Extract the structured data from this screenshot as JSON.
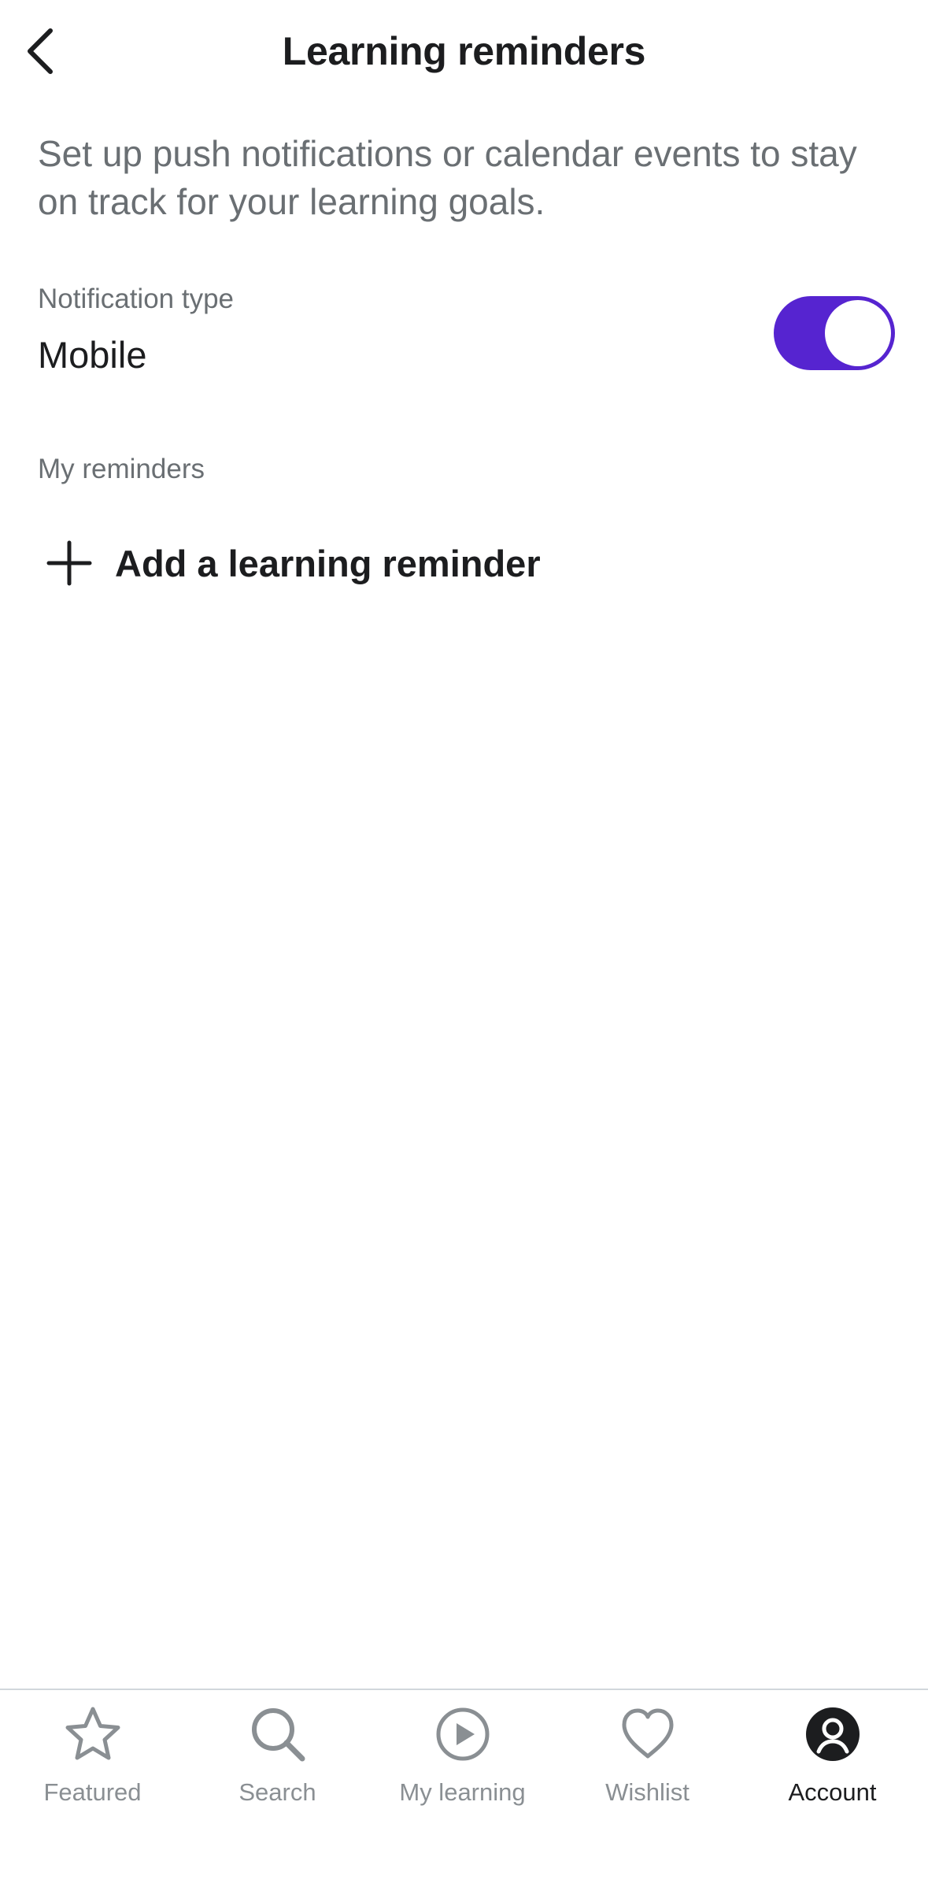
{
  "header": {
    "title": "Learning reminders",
    "back_icon": "chevron-left-icon"
  },
  "intro": {
    "text": "Set up push notifications or calendar events to stay on track for your learning goals."
  },
  "notification": {
    "label": "Notification type",
    "value": "Mobile",
    "toggle_on": true,
    "toggle_color": "#5624d0"
  },
  "reminders": {
    "section_label": "My reminders",
    "add_label": "Add a learning reminder",
    "add_icon": "plus-icon"
  },
  "bottom_nav": {
    "items": [
      {
        "label": "Featured",
        "icon": "star-icon",
        "active": false
      },
      {
        "label": "Search",
        "icon": "search-icon",
        "active": false
      },
      {
        "label": "My learning",
        "icon": "play-circle-icon",
        "active": false
      },
      {
        "label": "Wishlist",
        "icon": "heart-icon",
        "active": false
      },
      {
        "label": "Account",
        "icon": "account-icon",
        "active": true
      }
    ]
  },
  "colors": {
    "accent": "#5624d0",
    "text_primary": "#1c1d1f",
    "text_secondary": "#6a6f73",
    "nav_inactive": "#8a8f93"
  }
}
